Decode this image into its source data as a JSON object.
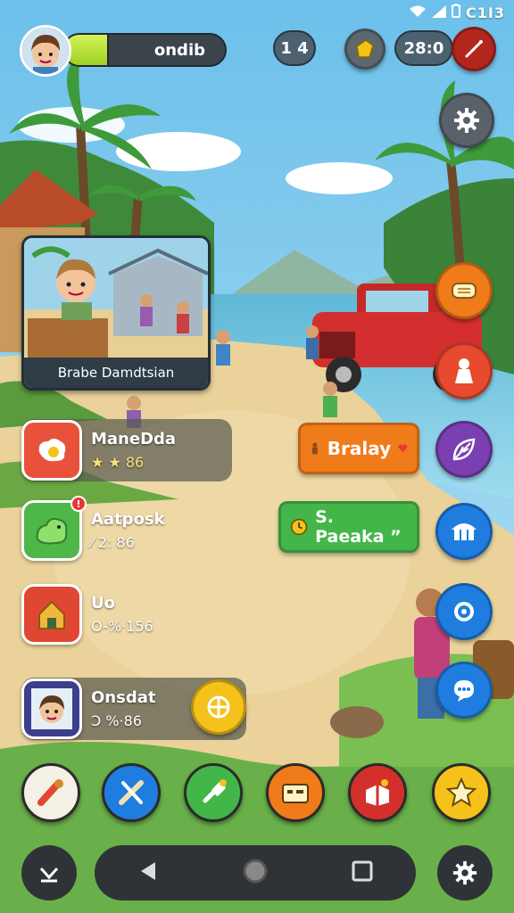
{
  "status_bar": {
    "text": "C1I3"
  },
  "hud": {
    "player_name": "ondib",
    "xp_progress": 0.28,
    "counter_a": "1 4",
    "timer": "28:0"
  },
  "event_card": {
    "caption": "Brabe Damdtsian"
  },
  "quests": [
    {
      "title": "ManeDda",
      "reward": "★ ★  86"
    },
    {
      "title": "Aatposk",
      "reward": "⁄ 2: 86"
    },
    {
      "title": "Uo",
      "reward": "O-%·156"
    },
    {
      "title": "Onsdat",
      "reward": "Ↄ %·86"
    }
  ],
  "actions": {
    "orange_label": "Bralay",
    "green_label": "S. Paeaka ”"
  },
  "colors": {
    "accent_red": "#c0392b",
    "orange": "#f07b1a",
    "green": "#43b649",
    "blue": "#1f7de0",
    "purple": "#7a3fb0",
    "yellow": "#f4c21a"
  },
  "icons": {
    "settings": "gear-icon",
    "dock": [
      "sausage-icon",
      "tools-icon",
      "plug-icon",
      "chest-icon",
      "gift-icon",
      "star-icon"
    ],
    "nav": [
      "back-icon",
      "home-icon",
      "recents-icon"
    ]
  }
}
